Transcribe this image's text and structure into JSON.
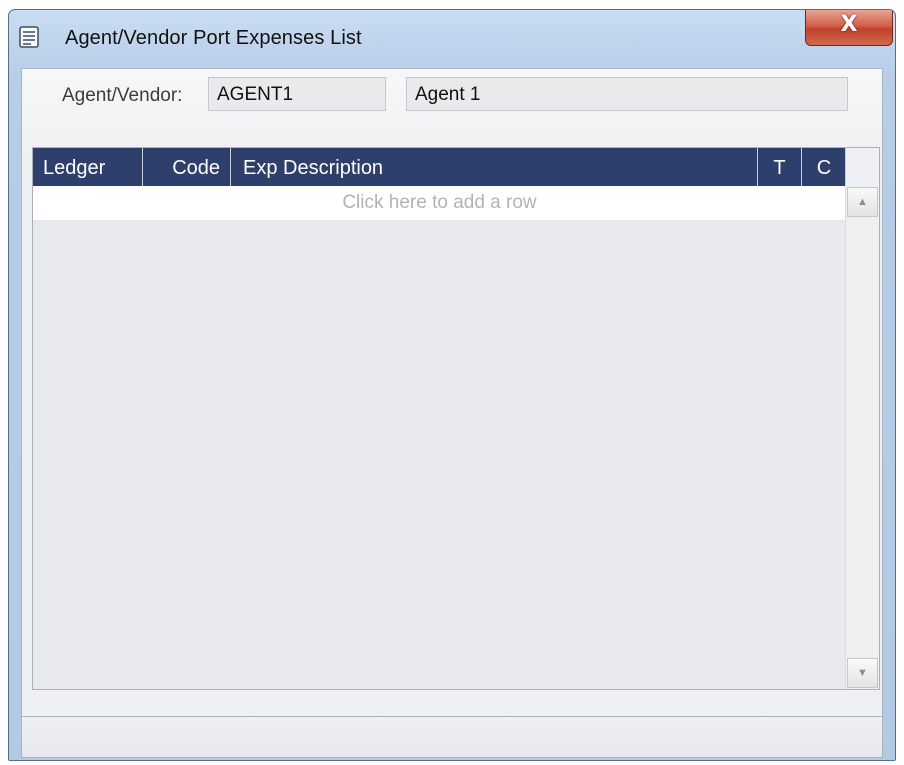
{
  "window": {
    "title": "Agent/Vendor Port Expenses List",
    "close_glyph": "X"
  },
  "form": {
    "agent_vendor_label": "Agent/Vendor:",
    "agent_code": "AGENT1",
    "agent_name": "Agent 1"
  },
  "grid": {
    "columns": [
      "Ledger",
      "Code",
      "Exp Description",
      "T",
      "C"
    ],
    "add_row_text": "Click here to add a row",
    "rows": []
  },
  "scrollbar": {
    "up_glyph": "▲",
    "down_glyph": "▼"
  },
  "icons": {
    "title_icon": "document-list-icon",
    "close_icon": "close-icon"
  }
}
